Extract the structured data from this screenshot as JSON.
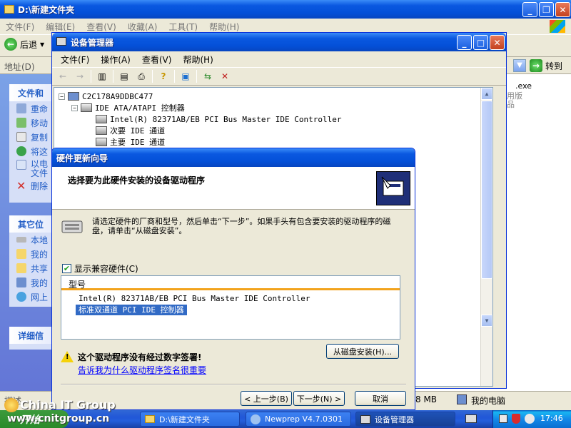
{
  "explorer": {
    "title": "D:\\新建文件夹",
    "menu": [
      "文件(F)",
      "编辑(E)",
      "查看(V)",
      "收藏(A)",
      "工具(T)",
      "帮助(H)"
    ],
    "back_label": "后退",
    "address_label": "地址(D)",
    "go_label": "转到",
    "file_tasks_head": "文件和",
    "file_tasks": [
      "重命",
      "移动",
      "复制",
      "将这",
      "以电",
      "文件",
      "删除"
    ],
    "other_places_head": "其它位",
    "other_places": [
      "本地",
      "我的",
      "共享",
      "我的",
      "网上"
    ],
    "details_head": "详细信",
    "right_frag": [
      ".exe",
      "用版",
      "品"
    ],
    "status_left": "描述",
    "status_size": "8 MB",
    "status_computer": "我的电脑"
  },
  "devmgr": {
    "title": "设备管理器",
    "menu": [
      "文件(F)",
      "操作(A)",
      "查看(V)",
      "帮助(H)"
    ],
    "tree": {
      "root": "C2C178A9DDBC477",
      "ide": "IDE ATA/ATAPI 控制器",
      "children": [
        "Intel(R) 82371AB/EB PCI Bus Master IDE Controller",
        "次要 IDE 通道",
        "主要 IDE 通道"
      ]
    }
  },
  "wizard": {
    "title": "硬件更新向导",
    "header_title": "选择要为此硬件安装的设备驱动程序",
    "description": "请选定硬件的厂商和型号，然后单击“下一步”。如果手头有包含要安装的驱动程序的磁盘，请单击“从磁盘安装”。",
    "show_compatible": "显示兼容硬件(C)",
    "model_header": "型号",
    "models": [
      "Intel(R) 82371AB/EB PCI Bus Master IDE Controller",
      "标准双通道 PCI IDE 控制器"
    ],
    "selected_model_index": 1,
    "warning": "这个驱动程序没有经过数字签署!",
    "warning_link": "告诉我为什么驱动程序签名很重要",
    "from_disk": "从磁盘安装(H)...",
    "back": "< 上一步(B)",
    "next": "下一步(N) >",
    "cancel": "取消"
  },
  "taskbar": {
    "start": "开始",
    "tasks": [
      "D:\\新建文件夹",
      "Newprep V4.7.0301",
      "设备管理器"
    ],
    "time": "17:46"
  },
  "watermark": {
    "line1": "China IT Group",
    "line2": "www.cnitgroup.cn"
  },
  "colors": {
    "titlebar": "#0450d8",
    "selection": "#316ac5",
    "link": "#0000ff",
    "taskbar": "#245edb"
  }
}
